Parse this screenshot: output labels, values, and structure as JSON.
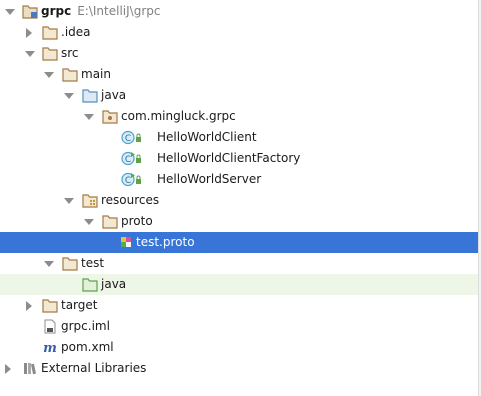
{
  "tree": {
    "root": {
      "label": "grpc",
      "path": "E:\\IntelliJ\\grpc"
    },
    "idea": "idea",
    "src": "src",
    "main": "main",
    "java_main": "java",
    "package": "com.mingluck.grpc",
    "class1": "HelloWorldClient",
    "class2": "HelloWorldClientFactory",
    "class3": "HelloWorldServer",
    "resources": "resources",
    "proto": "proto",
    "proto_file": "test.proto",
    "test": "test",
    "java_test": "java",
    "target": "target",
    "iml": "grpc.iml",
    "pom": "pom.xml",
    "libraries": "External Libraries"
  },
  "colors": {
    "selection": "#3875d7",
    "folder": "#a47a47",
    "source_folder": "#5a8fbc",
    "test_folder": "#5ea34a",
    "class_circle": "#4aa1cf"
  }
}
